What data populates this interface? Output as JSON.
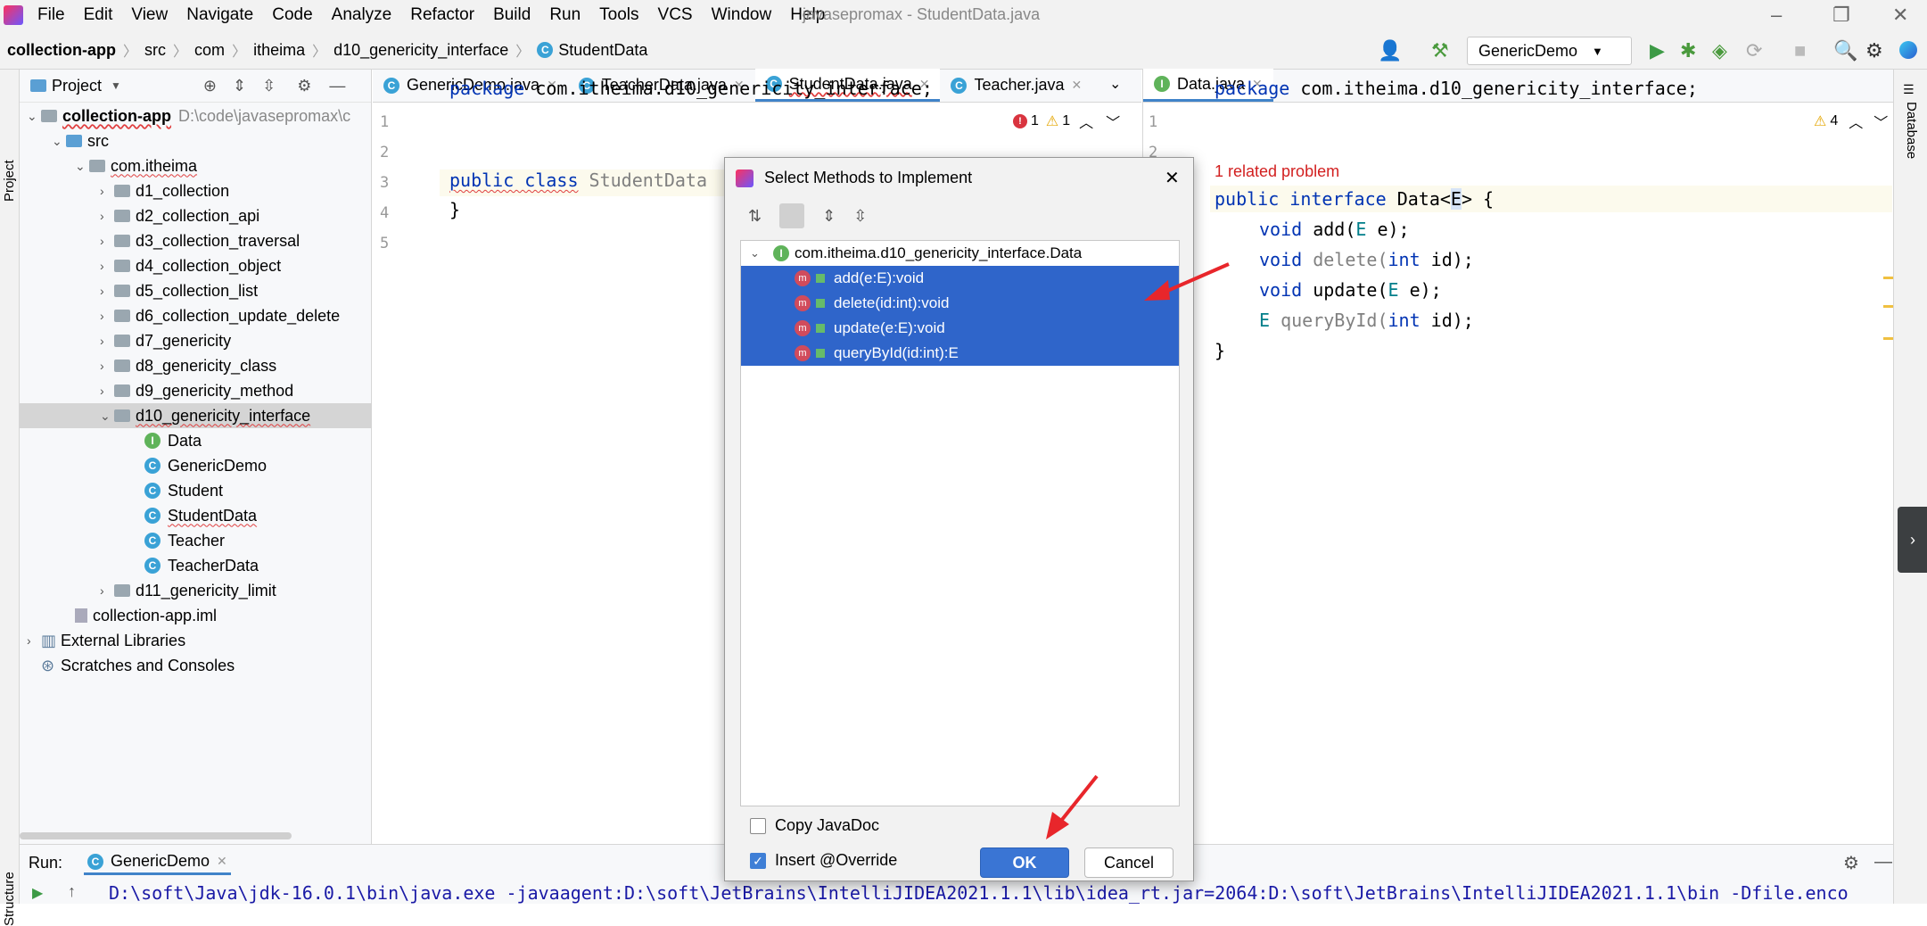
{
  "window": {
    "title": "javasepromax - StudentData.java"
  },
  "menu": [
    "File",
    "Edit",
    "View",
    "Navigate",
    "Code",
    "Analyze",
    "Refactor",
    "Build",
    "Run",
    "Tools",
    "VCS",
    "Window",
    "Help"
  ],
  "breadcrumb": [
    "collection-app",
    "src",
    "com",
    "itheima",
    "d10_genericity_interface",
    "StudentData"
  ],
  "toolbar": {
    "run_config": "GenericDemo"
  },
  "project": {
    "title": "Project",
    "root": {
      "name": "collection-app",
      "path": "D:\\code\\javasepromax\\c"
    },
    "src": "src",
    "package": "com.itheima",
    "folders": [
      "d1_collection",
      "d2_collection_api",
      "d3_collection_traversal",
      "d4_collection_object",
      "d5_collection_list",
      "d6_collection_update_delete",
      "d7_genericity",
      "d8_genericity_class",
      "d9_genericity_method",
      "d10_genericity_interface"
    ],
    "files": [
      "Data",
      "GenericDemo",
      "Student",
      "StudentData",
      "Teacher",
      "TeacherData"
    ],
    "after": [
      "d11_genericity_limit"
    ],
    "iml": "collection-app.iml",
    "ext": "External Libraries",
    "scratch": "Scratches and Consoles"
  },
  "left_strip": {
    "project": "Project",
    "structure": "Structure"
  },
  "right_strip": {
    "database": "Database"
  },
  "editor1": {
    "tabs": [
      "GenericDemo.java",
      "TeacherData.java",
      "StudentData.java",
      "Teacher.java"
    ],
    "line_numbers": [
      "1",
      "2",
      "3",
      "4",
      "5"
    ],
    "line1_kw": "package",
    "line1_rest": " com.itheima.d10_genericity_interface;",
    "line3_kw": "public class",
    "line3_rest": " StudentData",
    "line4": "}",
    "errors": "1",
    "warnings": "1"
  },
  "editor2": {
    "tab": "Data.java",
    "line_numbers": [
      "1",
      "2"
    ],
    "warnings": "4",
    "problem": "1 related problem",
    "l1_kw": "package",
    "l1_rest": " com.itheima.d10_genericity_interface;",
    "l3_kw": "public interface",
    "l3_a": " Data<",
    "l3_e": "E",
    "l3_b": "> {",
    "l4_kw": "void",
    "l4_rest": " add(",
    "l4_e": "E",
    "l4_end": " e);",
    "l5_kw": "void",
    "l5_rest": " delete(",
    "l5_int": "int",
    "l5_end": " id);",
    "l6_kw": "void",
    "l6_rest": " update(",
    "l6_e": "E",
    "l6_end": " e);",
    "l7_e": "E",
    "l7_rest": " queryById(",
    "l7_int": "int",
    "l7_end": " id);",
    "l8": "}"
  },
  "dialog": {
    "title": "Select Methods to Implement",
    "interface": "com.itheima.d10_genericity_interface.Data",
    "methods": [
      "add(e:E):void",
      "delete(id:int):void",
      "update(e:E):void",
      "queryById(id:int):E"
    ],
    "copy_javadoc": "Copy JavaDoc",
    "insert_override": "Insert @Override",
    "ok": "OK",
    "cancel": "Cancel"
  },
  "run": {
    "label": "Run:",
    "tab": "GenericDemo",
    "command": "D:\\soft\\Java\\jdk-16.0.1\\bin\\java.exe -javaagent:D:\\soft\\JetBrains\\IntelliJIDEA2021.1.1\\lib\\idea_rt.jar=2064:D:\\soft\\JetBrains\\IntelliJIDEA2021.1.1\\bin -Dfile.enco"
  }
}
